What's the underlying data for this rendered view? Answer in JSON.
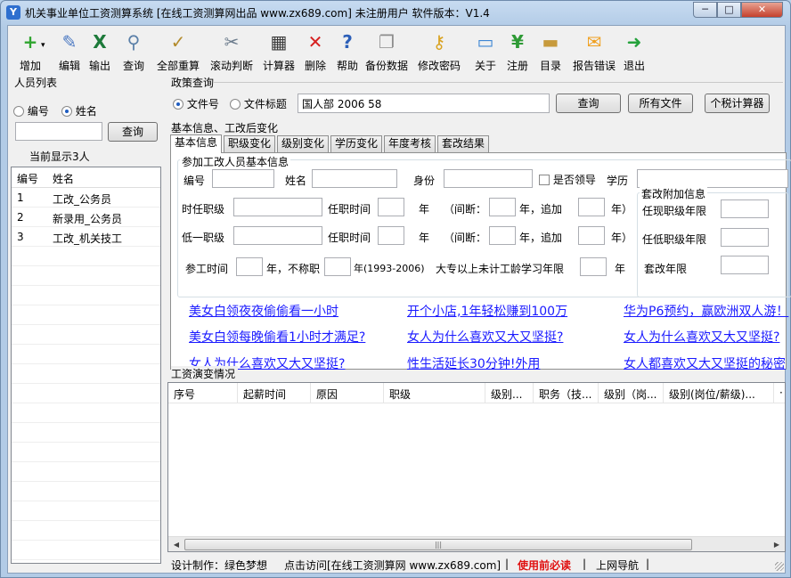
{
  "window": {
    "title": "机关事业单位工资测算系统 [在线工资测算网出品 www.zx689.com]  未注册用户  软件版本：V1.4",
    "min_glyph": "─",
    "max_glyph": "□",
    "close_glyph": "✕"
  },
  "toolbar": [
    {
      "label": "增加",
      "icon": "add-icon",
      "glyph": "+",
      "color": "#2fa52f",
      "arrow": "▾"
    },
    {
      "label": "编辑",
      "icon": "edit-icon",
      "glyph": "✎",
      "color": "#4a78c2"
    },
    {
      "label": "输出",
      "icon": "excel-icon",
      "glyph": "X",
      "color": "#1d7a3a"
    },
    {
      "label": "查询",
      "icon": "search-icon",
      "glyph": "⚲",
      "color": "#5a7fa8"
    },
    {
      "label": "全部重算",
      "icon": "recalc-icon",
      "glyph": "✓",
      "color": "#b38b2c"
    },
    {
      "label": "滚动判断",
      "icon": "tools-icon",
      "glyph": "✂",
      "color": "#6b7b8c"
    },
    {
      "label": "计算器",
      "icon": "calculator-icon",
      "glyph": "▦",
      "color": "#3b3b3b"
    },
    {
      "label": "删除",
      "icon": "delete-icon",
      "glyph": "✕",
      "color": "#d62020"
    },
    {
      "label": "帮助",
      "icon": "help-icon",
      "glyph": "?",
      "color": "#2c5fb8"
    },
    {
      "label": "备份数据",
      "icon": "backup-icon",
      "glyph": "❐",
      "color": "#8d8d8d"
    },
    {
      "label": "修改密码",
      "icon": "key-icon",
      "glyph": "⚷",
      "color": "#d9a21f"
    },
    {
      "label": "关于",
      "icon": "about-icon",
      "glyph": "▭",
      "color": "#3d86d4"
    },
    {
      "label": "注册",
      "icon": "register-icon",
      "glyph": "¥",
      "color": "#2e9a35"
    },
    {
      "label": "目录",
      "icon": "folder-icon",
      "glyph": "▬",
      "color": "#c79a3c"
    },
    {
      "label": "报告错误",
      "icon": "mail-icon",
      "glyph": "✉",
      "color": "#f0a020"
    },
    {
      "label": "退出",
      "icon": "exit-icon",
      "glyph": "➜",
      "color": "#25a23c"
    }
  ],
  "left": {
    "title": "人员列表",
    "radio_id": "编号",
    "radio_name": "姓名",
    "search_value": "",
    "query_button": "查询",
    "count_text": "当前显示3人",
    "columns": [
      "编号",
      "姓名"
    ],
    "rows": [
      {
        "id": "1",
        "name": "工改_公务员"
      },
      {
        "id": "2",
        "name": "新录用_公务员"
      },
      {
        "id": "3",
        "name": "工改_机关技工"
      }
    ]
  },
  "policy": {
    "title": "政策查询",
    "radio_doc_no": "文件号",
    "radio_doc_title": "文件标题",
    "search_value": "国人部 2006 58",
    "query_button": "查询",
    "all_files_button": "所有文件",
    "tax_calc_button": "个税计算器"
  },
  "basic": {
    "section_title": "基本信息、工改后变化",
    "tabs": [
      "基本信息",
      "职级变化",
      "级别变化",
      "学历变化",
      "年度考核",
      "套改结果"
    ],
    "group_title": "参加工改人员基本信息",
    "id_label": "编号",
    "name_label": "姓名",
    "identity_label": "身份",
    "leader_label": "是否领导",
    "edu_label": "学历",
    "position_label": "时任职级",
    "term_label": "任职时间",
    "year_label": "年",
    "gap_label": "（间断：",
    "extra_label": "年，追加",
    "close_label": "年）",
    "low_label": "低一职级",
    "work_label": "参工时间",
    "not_fit_label": "年，不称职",
    "range_label": "年(1993-2006)",
    "college_label": "大专以上未计工龄学习年限",
    "extra_group_title": "套改附加信息",
    "cur_years_label": "任现职级年限",
    "low_years_label": "任低职级年限",
    "reform_years_label": "套改年限"
  },
  "ads": [
    "美女白领夜夜偷偷看一小时",
    "开个小店,1年轻松赚到100万",
    "华为P6预约，赢欧洲双人游！",
    "美女白领每晚偷看1小时才满足?",
    "女人为什么喜欢又大又坚挺?",
    "女人为什么喜欢又大又坚挺?",
    "女人为什么喜欢又大又坚挺?",
    "性生活延长30分钟!外用",
    "女人都喜欢又大又坚挺的秘密"
  ],
  "salary": {
    "title": "工资演变情况",
    "columns": [
      "序号",
      "起薪时间",
      "原因",
      "职级",
      "级别...",
      "职务（技...",
      "级别（岗...",
      "级别(岗位/薪级)...",
      "·"
    ],
    "scroll_thumb": "|||",
    "arrow_left": "◀",
    "arrow_right": "▶"
  },
  "status": {
    "design": "设计制作：绿色梦想",
    "visit": "点击访问[在线工资测算网 www.zx689.com]",
    "sep": "|",
    "must_read": "使用前必读",
    "nav": "上网导航"
  }
}
